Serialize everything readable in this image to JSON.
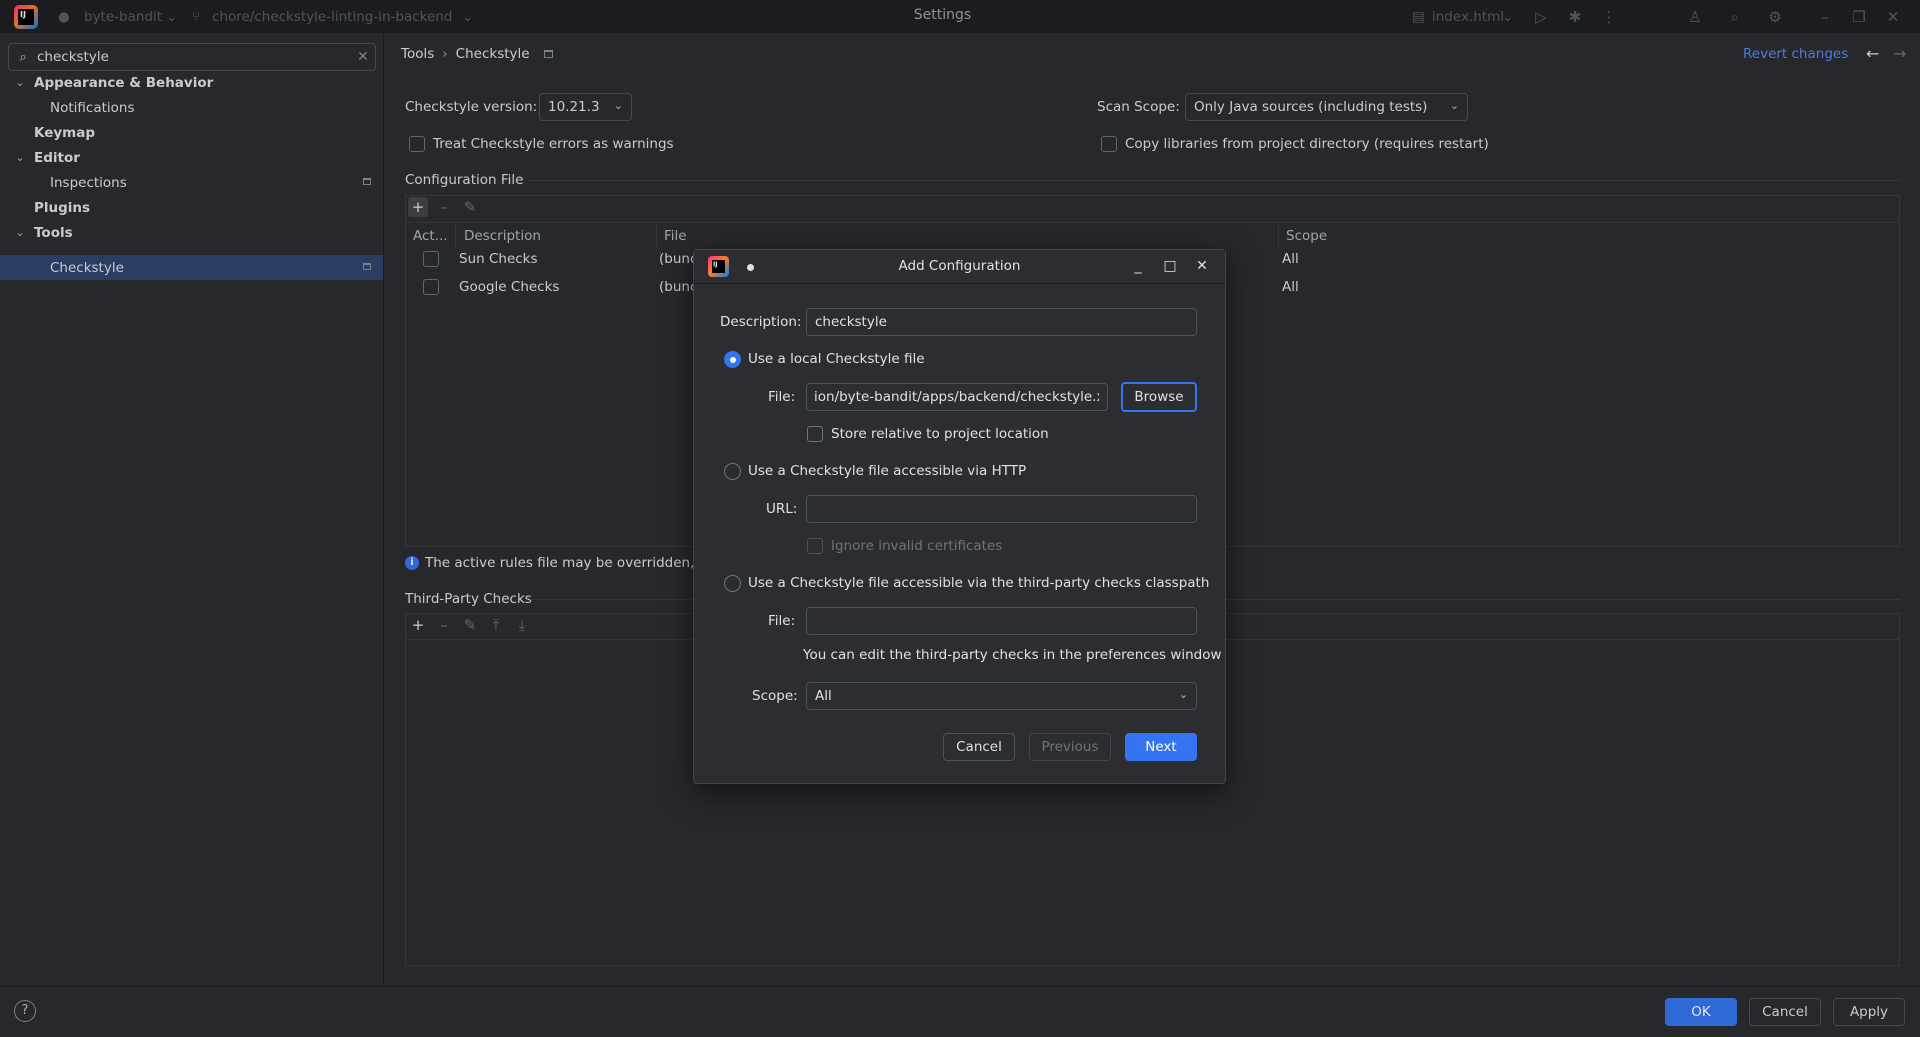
{
  "titlebar": {
    "project": "byte-bandit",
    "branch": "chore/checkstyle-linting-in-backend",
    "window_title": "Settings",
    "run_config": "index.html"
  },
  "sidebar": {
    "search_value": "checkstyle",
    "items": [
      {
        "label": "Appearance & Behavior",
        "level": 0,
        "expanded": true
      },
      {
        "label": "Notifications",
        "level": 1
      },
      {
        "label": "Keymap",
        "level": 0
      },
      {
        "label": "Editor",
        "level": 0,
        "expanded": true
      },
      {
        "label": "Inspections",
        "level": 1
      },
      {
        "label": "Plugins",
        "level": 0
      },
      {
        "label": "Tools",
        "level": 0,
        "expanded": true
      },
      {
        "label": "Checkstyle",
        "level": 1,
        "selected": true
      }
    ]
  },
  "breadcrumb": {
    "parent": "Tools",
    "current": "Checkstyle",
    "separator": "›"
  },
  "revert_changes": "Revert changes",
  "checkstyle": {
    "version_label": "Checkstyle version:",
    "version_value": "10.21.3",
    "scan_scope_label": "Scan Scope:",
    "scan_scope_value": "Only Java sources (including tests)",
    "treat_errors_label": "Treat Checkstyle errors as warnings",
    "copy_libs_label": "Copy libraries from project directory (requires restart)",
    "config_file_title": "Configuration File",
    "columns": [
      "Act...",
      "Description",
      "File",
      "Scope"
    ],
    "rows": [
      {
        "description": "Sun Checks",
        "file": "(bunc",
        "scope": "All"
      },
      {
        "description": "Google Checks",
        "file": "(bunc",
        "scope": "All"
      }
    ],
    "info_text": "The active rules file may be overridden, or",
    "third_party_title": "Third-Party Checks"
  },
  "footer": {
    "ok": "OK",
    "cancel": "Cancel",
    "apply": "Apply",
    "help": "?"
  },
  "dialog": {
    "title": "Add Configuration",
    "description_label": "Description:",
    "description_value": "checkstyle",
    "local_option": "Use a local Checkstyle file",
    "file_label": "File:",
    "file_value": "ion/byte-bandit/apps/backend/checkstyle.xml",
    "browse": "Browse",
    "store_relative": "Store relative to project location",
    "http_option": "Use a Checkstyle file accessible via HTTP",
    "url_label": "URL:",
    "url_value": "",
    "ignore_certs": "Ignore invalid certificates",
    "classpath_option": "Use a Checkstyle file accessible via the third-party checks classpath",
    "classpath_file_label": "File:",
    "classpath_file_value": "",
    "classpath_hint": "You can edit the third-party checks in the preferences window",
    "scope_label": "Scope:",
    "scope_value": "All",
    "cancel": "Cancel",
    "previous": "Previous",
    "next": "Next"
  },
  "colors": {
    "accent": "#3574f0",
    "selection": "#2e436e",
    "link": "#548af7",
    "background": "#2b2d30"
  }
}
